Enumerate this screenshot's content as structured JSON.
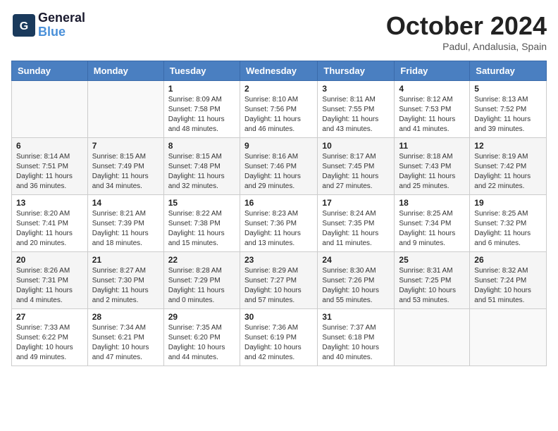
{
  "header": {
    "logo_general": "General",
    "logo_blue": "Blue",
    "month": "October 2024",
    "location": "Padul, Andalusia, Spain"
  },
  "weekdays": [
    "Sunday",
    "Monday",
    "Tuesday",
    "Wednesday",
    "Thursday",
    "Friday",
    "Saturday"
  ],
  "weeks": [
    [
      {
        "day": "",
        "sunrise": "",
        "sunset": "",
        "daylight": ""
      },
      {
        "day": "",
        "sunrise": "",
        "sunset": "",
        "daylight": ""
      },
      {
        "day": "1",
        "sunrise": "Sunrise: 8:09 AM",
        "sunset": "Sunset: 7:58 PM",
        "daylight": "Daylight: 11 hours and 48 minutes."
      },
      {
        "day": "2",
        "sunrise": "Sunrise: 8:10 AM",
        "sunset": "Sunset: 7:56 PM",
        "daylight": "Daylight: 11 hours and 46 minutes."
      },
      {
        "day": "3",
        "sunrise": "Sunrise: 8:11 AM",
        "sunset": "Sunset: 7:55 PM",
        "daylight": "Daylight: 11 hours and 43 minutes."
      },
      {
        "day": "4",
        "sunrise": "Sunrise: 8:12 AM",
        "sunset": "Sunset: 7:53 PM",
        "daylight": "Daylight: 11 hours and 41 minutes."
      },
      {
        "day": "5",
        "sunrise": "Sunrise: 8:13 AM",
        "sunset": "Sunset: 7:52 PM",
        "daylight": "Daylight: 11 hours and 39 minutes."
      }
    ],
    [
      {
        "day": "6",
        "sunrise": "Sunrise: 8:14 AM",
        "sunset": "Sunset: 7:51 PM",
        "daylight": "Daylight: 11 hours and 36 minutes."
      },
      {
        "day": "7",
        "sunrise": "Sunrise: 8:15 AM",
        "sunset": "Sunset: 7:49 PM",
        "daylight": "Daylight: 11 hours and 34 minutes."
      },
      {
        "day": "8",
        "sunrise": "Sunrise: 8:15 AM",
        "sunset": "Sunset: 7:48 PM",
        "daylight": "Daylight: 11 hours and 32 minutes."
      },
      {
        "day": "9",
        "sunrise": "Sunrise: 8:16 AM",
        "sunset": "Sunset: 7:46 PM",
        "daylight": "Daylight: 11 hours and 29 minutes."
      },
      {
        "day": "10",
        "sunrise": "Sunrise: 8:17 AM",
        "sunset": "Sunset: 7:45 PM",
        "daylight": "Daylight: 11 hours and 27 minutes."
      },
      {
        "day": "11",
        "sunrise": "Sunrise: 8:18 AM",
        "sunset": "Sunset: 7:43 PM",
        "daylight": "Daylight: 11 hours and 25 minutes."
      },
      {
        "day": "12",
        "sunrise": "Sunrise: 8:19 AM",
        "sunset": "Sunset: 7:42 PM",
        "daylight": "Daylight: 11 hours and 22 minutes."
      }
    ],
    [
      {
        "day": "13",
        "sunrise": "Sunrise: 8:20 AM",
        "sunset": "Sunset: 7:41 PM",
        "daylight": "Daylight: 11 hours and 20 minutes."
      },
      {
        "day": "14",
        "sunrise": "Sunrise: 8:21 AM",
        "sunset": "Sunset: 7:39 PM",
        "daylight": "Daylight: 11 hours and 18 minutes."
      },
      {
        "day": "15",
        "sunrise": "Sunrise: 8:22 AM",
        "sunset": "Sunset: 7:38 PM",
        "daylight": "Daylight: 11 hours and 15 minutes."
      },
      {
        "day": "16",
        "sunrise": "Sunrise: 8:23 AM",
        "sunset": "Sunset: 7:36 PM",
        "daylight": "Daylight: 11 hours and 13 minutes."
      },
      {
        "day": "17",
        "sunrise": "Sunrise: 8:24 AM",
        "sunset": "Sunset: 7:35 PM",
        "daylight": "Daylight: 11 hours and 11 minutes."
      },
      {
        "day": "18",
        "sunrise": "Sunrise: 8:25 AM",
        "sunset": "Sunset: 7:34 PM",
        "daylight": "Daylight: 11 hours and 9 minutes."
      },
      {
        "day": "19",
        "sunrise": "Sunrise: 8:25 AM",
        "sunset": "Sunset: 7:32 PM",
        "daylight": "Daylight: 11 hours and 6 minutes."
      }
    ],
    [
      {
        "day": "20",
        "sunrise": "Sunrise: 8:26 AM",
        "sunset": "Sunset: 7:31 PM",
        "daylight": "Daylight: 11 hours and 4 minutes."
      },
      {
        "day": "21",
        "sunrise": "Sunrise: 8:27 AM",
        "sunset": "Sunset: 7:30 PM",
        "daylight": "Daylight: 11 hours and 2 minutes."
      },
      {
        "day": "22",
        "sunrise": "Sunrise: 8:28 AM",
        "sunset": "Sunset: 7:29 PM",
        "daylight": "Daylight: 11 hours and 0 minutes."
      },
      {
        "day": "23",
        "sunrise": "Sunrise: 8:29 AM",
        "sunset": "Sunset: 7:27 PM",
        "daylight": "Daylight: 10 hours and 57 minutes."
      },
      {
        "day": "24",
        "sunrise": "Sunrise: 8:30 AM",
        "sunset": "Sunset: 7:26 PM",
        "daylight": "Daylight: 10 hours and 55 minutes."
      },
      {
        "day": "25",
        "sunrise": "Sunrise: 8:31 AM",
        "sunset": "Sunset: 7:25 PM",
        "daylight": "Daylight: 10 hours and 53 minutes."
      },
      {
        "day": "26",
        "sunrise": "Sunrise: 8:32 AM",
        "sunset": "Sunset: 7:24 PM",
        "daylight": "Daylight: 10 hours and 51 minutes."
      }
    ],
    [
      {
        "day": "27",
        "sunrise": "Sunrise: 7:33 AM",
        "sunset": "Sunset: 6:22 PM",
        "daylight": "Daylight: 10 hours and 49 minutes."
      },
      {
        "day": "28",
        "sunrise": "Sunrise: 7:34 AM",
        "sunset": "Sunset: 6:21 PM",
        "daylight": "Daylight: 10 hours and 47 minutes."
      },
      {
        "day": "29",
        "sunrise": "Sunrise: 7:35 AM",
        "sunset": "Sunset: 6:20 PM",
        "daylight": "Daylight: 10 hours and 44 minutes."
      },
      {
        "day": "30",
        "sunrise": "Sunrise: 7:36 AM",
        "sunset": "Sunset: 6:19 PM",
        "daylight": "Daylight: 10 hours and 42 minutes."
      },
      {
        "day": "31",
        "sunrise": "Sunrise: 7:37 AM",
        "sunset": "Sunset: 6:18 PM",
        "daylight": "Daylight: 10 hours and 40 minutes."
      },
      {
        "day": "",
        "sunrise": "",
        "sunset": "",
        "daylight": ""
      },
      {
        "day": "",
        "sunrise": "",
        "sunset": "",
        "daylight": ""
      }
    ]
  ]
}
